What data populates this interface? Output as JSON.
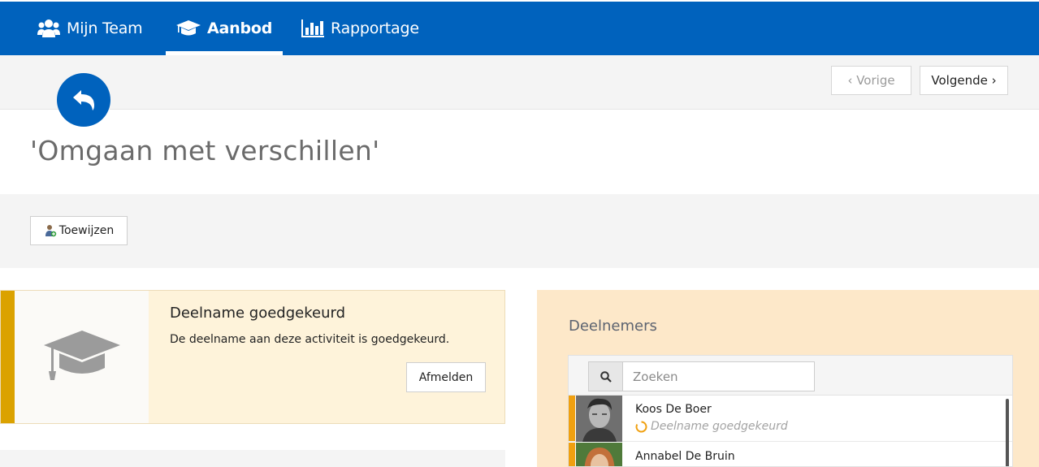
{
  "nav": {
    "items": [
      {
        "label": "Mijn Team",
        "icon": "team-icon"
      },
      {
        "label": "Aanbod",
        "icon": "graduation-cap-icon",
        "active": true
      },
      {
        "label": "Rapportage",
        "icon": "bar-chart-icon"
      }
    ]
  },
  "pager": {
    "prev_label": "‹ Vorige",
    "next_label": "Volgende ›"
  },
  "page": {
    "title": "'Omgaan met verschillen'"
  },
  "actions": {
    "assign_label": "Toewijzen"
  },
  "status": {
    "title": "Deelname goedgekeurd",
    "description": "De deelname aan deze activiteit is goedgekeurd.",
    "unsubscribe_label": "Afmelden",
    "accent_color": "#dba200"
  },
  "participants": {
    "title": "Deelnemers",
    "search_placeholder": "Zoeken",
    "people": [
      {
        "name": "Koos De Boer",
        "status": "Deelname goedgekeurd"
      },
      {
        "name": "Annabel De Bruin",
        "status": ""
      }
    ]
  },
  "colors": {
    "primary": "#0062bd",
    "warning": "#f0a010",
    "panel": "#fde8c9"
  }
}
